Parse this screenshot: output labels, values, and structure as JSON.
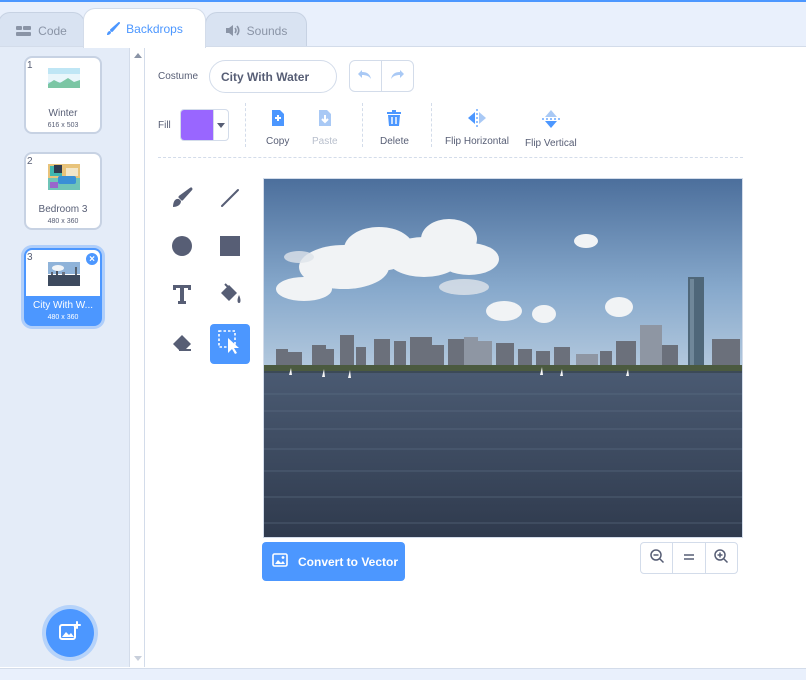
{
  "tabs": [
    {
      "label": "Code",
      "icon": "code-icon"
    },
    {
      "label": "Backdrops",
      "icon": "paintbrush-icon"
    },
    {
      "label": "Sounds",
      "icon": "speaker-icon"
    }
  ],
  "backdrops": [
    {
      "number": "1",
      "name": "Winter",
      "size": "616 x 503"
    },
    {
      "number": "2",
      "name": "Bedroom 3",
      "size": "480 x 360"
    },
    {
      "number": "3",
      "name": "City With W...",
      "size": "480 x 360"
    }
  ],
  "editor": {
    "costume_label": "Costume",
    "costume_name": "City With Water",
    "fill_label": "Fill",
    "fill_color": "#9966ff",
    "actions": {
      "copy": "Copy",
      "paste": "Paste",
      "delete": "Delete",
      "flip_horizontal": "Flip Horizontal",
      "flip_vertical": "Flip Vertical"
    },
    "tools": [
      "brush",
      "line",
      "circle",
      "rectangle",
      "text",
      "fill",
      "eraser",
      "select"
    ],
    "active_tool": "select",
    "convert_label": "Convert to Vector"
  },
  "colors": {
    "accent": "#4c97ff",
    "text": "#575e75"
  }
}
